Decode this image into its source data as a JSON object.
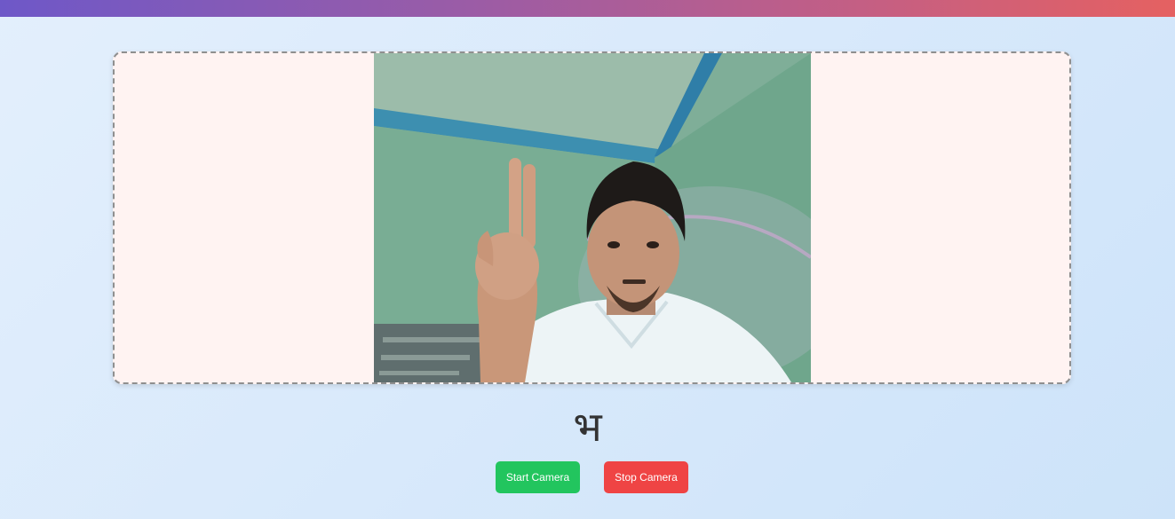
{
  "prediction": {
    "character": "भ"
  },
  "controls": {
    "start_label": "Start Camera",
    "stop_label": "Stop Camera"
  },
  "colors": {
    "start_button": "#22c55e",
    "stop_button": "#ef4444",
    "frame_border": "#8f8f8f",
    "frame_background": "#fff3f2"
  }
}
